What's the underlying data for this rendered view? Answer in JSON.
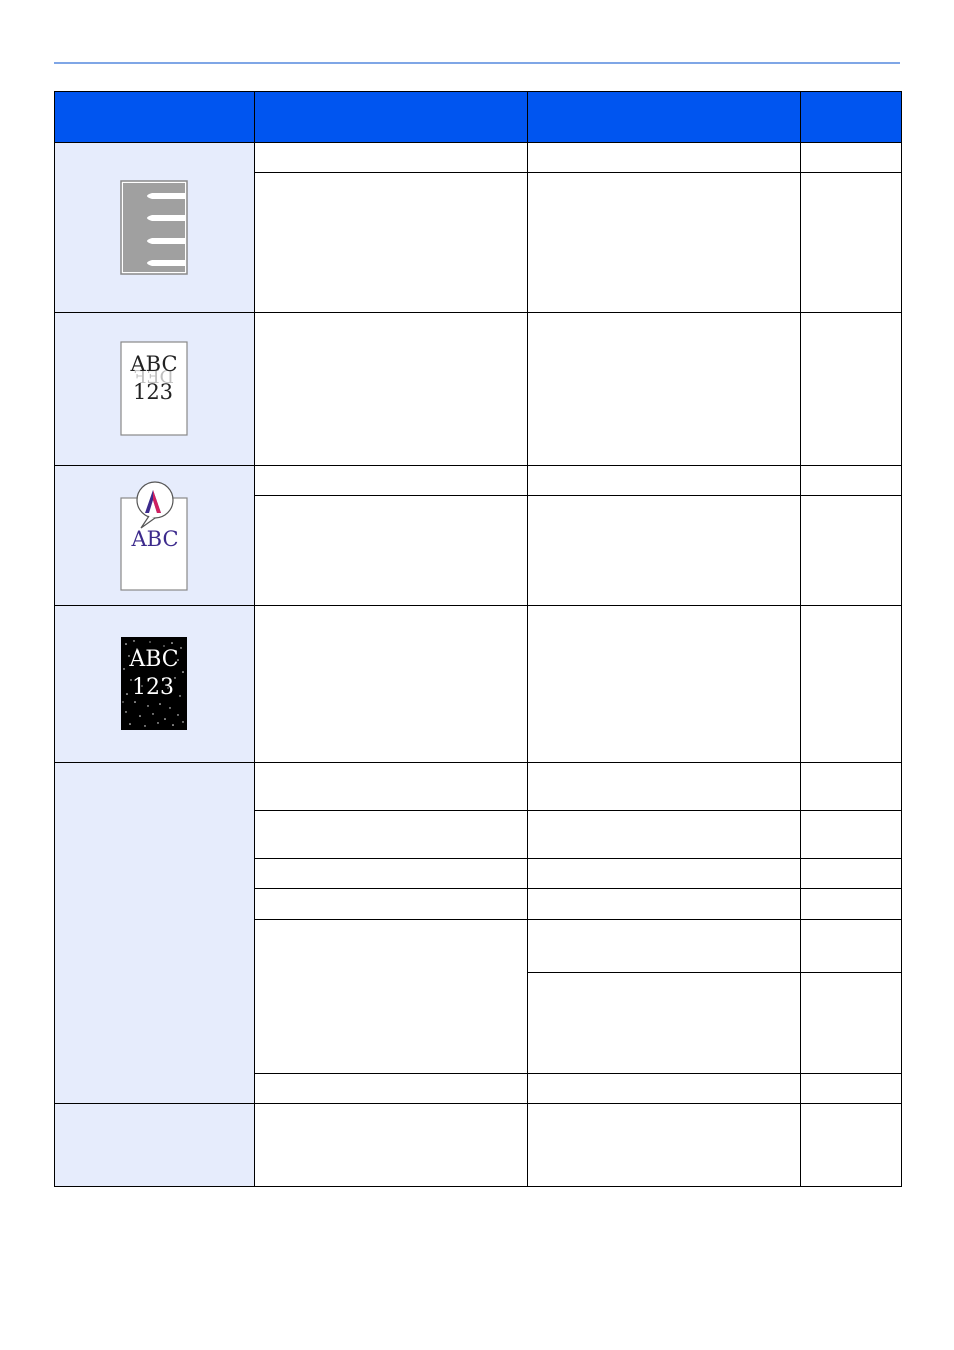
{
  "header": {
    "col1": "",
    "col2": "",
    "col3": "",
    "col4": ""
  },
  "images": {
    "img1": {
      "name": "stripes-thumbnail"
    },
    "img2": {
      "name": "ghost-text-thumbnail",
      "line1": "ABC",
      "line2": "123",
      "ghost": "DEF"
    },
    "img3": {
      "name": "magnified-letter-thumbnail",
      "letter": "A",
      "text": "ABC"
    },
    "img4": {
      "name": "speckled-text-thumbnail",
      "line1": "ABC",
      "line2": "123"
    }
  },
  "colors": {
    "header_bg": "#0055f0",
    "symptom_bg": "#e6ecfc",
    "rule": "#7fa6e6",
    "purple_text": "#3c2a8c"
  }
}
